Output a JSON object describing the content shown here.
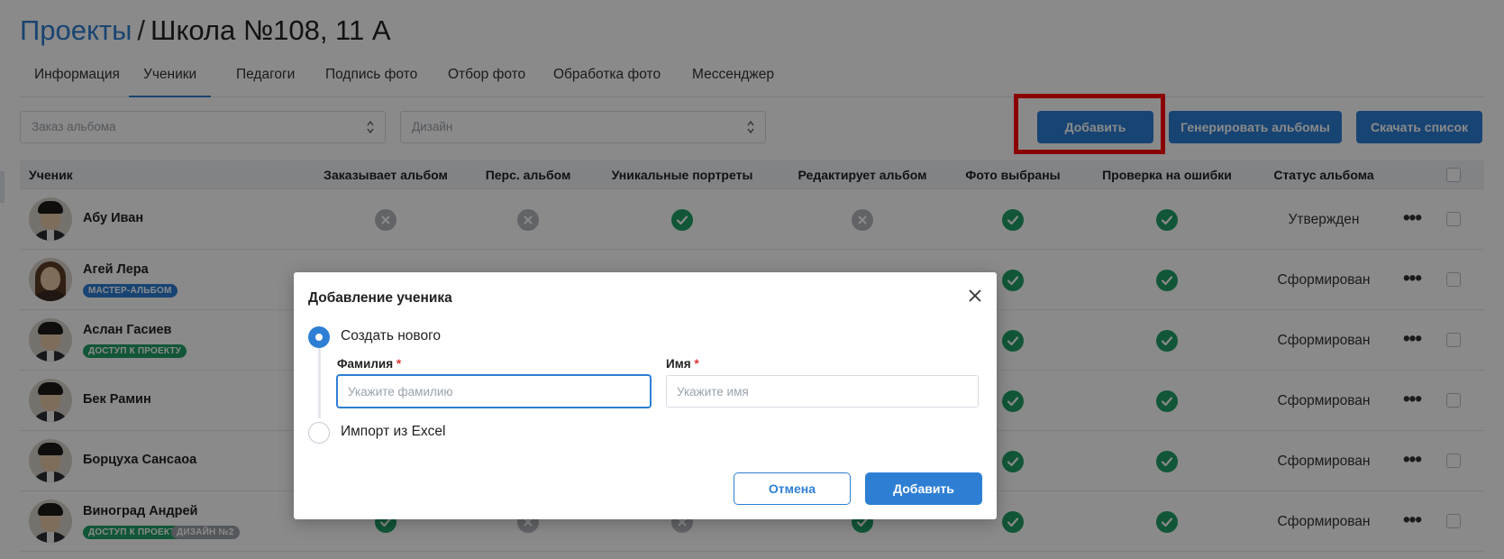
{
  "breadcrumb": {
    "root": "Проекты",
    "separator": "/",
    "current": "Школа №108, 11 А"
  },
  "tabs": [
    {
      "label": "Информация"
    },
    {
      "label": "Ученики",
      "active": true
    },
    {
      "label": "Педагоги"
    },
    {
      "label": "Подпись фото"
    },
    {
      "label": "Отбор фото"
    },
    {
      "label": "Обработка фото"
    },
    {
      "label": "Мессенджер"
    }
  ],
  "filters": {
    "album_order_placeholder": "Заказ альбома",
    "design_placeholder": "Дизайн"
  },
  "toolbar": {
    "add_label": "Добавить",
    "generate_label": "Генерировать альбомы",
    "download_label": "Скачать список"
  },
  "table": {
    "headers": {
      "student": "Ученик",
      "orders_album": "Заказывает альбом",
      "personal_album": "Перс. альбом",
      "unique_portraits": "Уникальные портреты",
      "edits_album": "Редактирует альбом",
      "photos_selected": "Фото выбраны",
      "error_check": "Проверка на ошибки",
      "album_status": "Статус альбома"
    },
    "rows": [
      {
        "name": "Абу Иван",
        "badges": [],
        "avatar": "male",
        "flags": [
          "no",
          "no",
          "ok",
          "no",
          "ok",
          "ok"
        ],
        "status": "Утвержден"
      },
      {
        "name": "Агей Лера",
        "badges": [
          {
            "text": "МАСТЕР-АЛЬБОМ",
            "color": "blue"
          }
        ],
        "avatar": "female",
        "flags": [
          "hidden",
          "hidden",
          "hidden",
          "hidden",
          "ok",
          "ok"
        ],
        "status": "Сформирован"
      },
      {
        "name": "Аслан Гасиев",
        "badges": [
          {
            "text": "ДОСТУП К ПРОЕКТУ",
            "color": "green"
          }
        ],
        "avatar": "male",
        "flags": [
          "hidden",
          "hidden",
          "hidden",
          "hidden",
          "ok",
          "ok"
        ],
        "status": "Сформирован"
      },
      {
        "name": "Бек Рамин",
        "badges": [],
        "avatar": "male",
        "flags": [
          "hidden",
          "hidden",
          "hidden",
          "hidden",
          "ok",
          "ok"
        ],
        "status": "Сформирован"
      },
      {
        "name": "Борцуха Сансаоа",
        "badges": [],
        "avatar": "male",
        "flags": [
          "hidden",
          "hidden",
          "hidden",
          "hidden",
          "ok",
          "ok"
        ],
        "status": "Сформирован"
      },
      {
        "name": "Виноград Андрей",
        "badges": [
          {
            "text": "ДОСТУП К ПРОЕКТУ",
            "color": "green"
          },
          {
            "text": "ДИЗАЙН №2",
            "color": "gray"
          }
        ],
        "avatar": "male",
        "flags": [
          "ok",
          "no",
          "no",
          "ok",
          "ok",
          "ok"
        ],
        "status": "Сформирован"
      }
    ]
  },
  "modal": {
    "title": "Добавление ученика",
    "option_new": "Создать нового",
    "option_import": "Импорт из Excel",
    "last_name_label": "Фамилия",
    "first_name_label": "Имя",
    "required_mark": "*",
    "last_name_placeholder": "Укажите фамилию",
    "first_name_placeholder": "Укажите имя",
    "cancel_label": "Отмена",
    "submit_label": "Добавить"
  },
  "colors": {
    "accent": "#2e7fd4",
    "success": "#21a067",
    "highlight": "#ff0000"
  }
}
